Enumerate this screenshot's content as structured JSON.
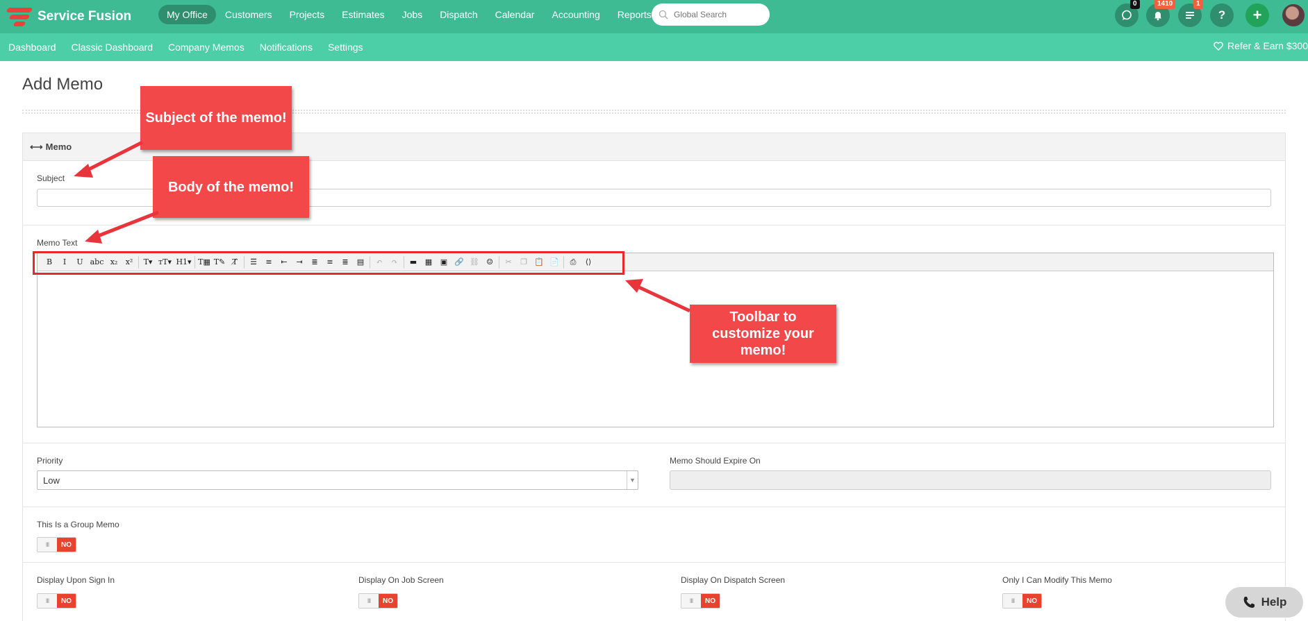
{
  "brand": {
    "name": "Service Fusion",
    "accent": "#3ebb92",
    "subnav_color": "#4ccfa6",
    "annotation_color": "#f2484a"
  },
  "top_nav": [
    {
      "label": "My Office",
      "active": true
    },
    {
      "label": "Customers"
    },
    {
      "label": "Projects"
    },
    {
      "label": "Estimates"
    },
    {
      "label": "Jobs"
    },
    {
      "label": "Dispatch"
    },
    {
      "label": "Calendar"
    },
    {
      "label": "Accounting"
    },
    {
      "label": "Reports"
    }
  ],
  "search": {
    "placeholder": "Global Search",
    "icon": "search-icon"
  },
  "header_icons": [
    {
      "name": "chat-icon",
      "badge": "0",
      "badge_color": "#111111"
    },
    {
      "name": "bell-icon",
      "badge": "1410",
      "badge_color": "#f0623e"
    },
    {
      "name": "list-icon",
      "badge": "1",
      "badge_color": "#f0623e"
    },
    {
      "name": "help-icon",
      "badge": ""
    },
    {
      "name": "plus-icon",
      "badge": ""
    }
  ],
  "sub_nav": [
    "Dashboard",
    "Classic Dashboard",
    "Company Memos",
    "Notifications",
    "Settings"
  ],
  "refer": {
    "label": "Refer & Earn $300",
    "icon": "heart-icon"
  },
  "page": {
    "title": "Add Memo",
    "panel_title": "Memo",
    "subject_label": "Subject",
    "memo_text_label": "Memo Text",
    "priority_label": "Priority",
    "priority_value": "Low",
    "expire_label": "Memo Should Expire On",
    "group_memo_label": "This Is a Group Memo",
    "group_memo_state": "NO",
    "options": [
      {
        "label": "Display Upon Sign In",
        "state": "NO"
      },
      {
        "label": "Display On Job Screen",
        "state": "NO"
      },
      {
        "label": "Display On Dispatch Screen",
        "state": "NO"
      },
      {
        "label": "Only I Can Modify This Memo",
        "state": "NO"
      }
    ]
  },
  "toolbar": [
    {
      "name": "bold-icon",
      "glyph": "B"
    },
    {
      "name": "italic-icon",
      "glyph": "I"
    },
    {
      "name": "underline-icon",
      "glyph": "U"
    },
    {
      "name": "strikethrough-icon",
      "glyph": "abc"
    },
    {
      "name": "subscript-icon",
      "glyph": "x₂"
    },
    {
      "name": "superscript-icon",
      "glyph": "x²"
    },
    {
      "name": "sep"
    },
    {
      "name": "font-family-icon",
      "glyph": "T▾"
    },
    {
      "name": "font-size-icon",
      "glyph": "тT▾"
    },
    {
      "name": "heading-icon",
      "glyph": "H1▾"
    },
    {
      "name": "sep"
    },
    {
      "name": "text-color-icon",
      "glyph": "T▦"
    },
    {
      "name": "highlight-icon",
      "glyph": "T✎"
    },
    {
      "name": "clear-format-icon",
      "glyph": "T̸"
    },
    {
      "name": "sep"
    },
    {
      "name": "bullet-list-icon",
      "glyph": "☰"
    },
    {
      "name": "numbered-list-icon",
      "glyph": "≡"
    },
    {
      "name": "outdent-icon",
      "glyph": "⇤"
    },
    {
      "name": "indent-icon",
      "glyph": "⇥"
    },
    {
      "name": "align-left-icon",
      "glyph": "≣"
    },
    {
      "name": "align-center-icon",
      "glyph": "≡"
    },
    {
      "name": "align-right-icon",
      "glyph": "≣"
    },
    {
      "name": "justify-icon",
      "glyph": "▤"
    },
    {
      "name": "sep"
    },
    {
      "name": "undo-icon",
      "glyph": "↶",
      "dim": true
    },
    {
      "name": "redo-icon",
      "glyph": "↷",
      "dim": true
    },
    {
      "name": "sep"
    },
    {
      "name": "horizontal-rule-icon",
      "glyph": "▬"
    },
    {
      "name": "table-icon",
      "glyph": "▦"
    },
    {
      "name": "image-icon",
      "glyph": "▣"
    },
    {
      "name": "link-icon",
      "glyph": "🔗"
    },
    {
      "name": "unlink-icon",
      "glyph": "⛓",
      "dim": true
    },
    {
      "name": "emoticon-icon",
      "glyph": "☺"
    },
    {
      "name": "sep"
    },
    {
      "name": "cut-icon",
      "glyph": "✂",
      "dim": true
    },
    {
      "name": "copy-icon",
      "glyph": "❐",
      "dim": true
    },
    {
      "name": "paste-icon",
      "glyph": "📋"
    },
    {
      "name": "paste-text-icon",
      "glyph": "📄"
    },
    {
      "name": "sep"
    },
    {
      "name": "print-icon",
      "glyph": "⎙"
    },
    {
      "name": "source-code-icon",
      "glyph": "⟨⟩"
    }
  ],
  "annotations": {
    "subject": "Subject of the memo!",
    "body": "Body of the memo!",
    "toolbar": "Toolbar to customize your memo!"
  },
  "help_button": {
    "label": "Help",
    "icon": "phone-icon"
  }
}
